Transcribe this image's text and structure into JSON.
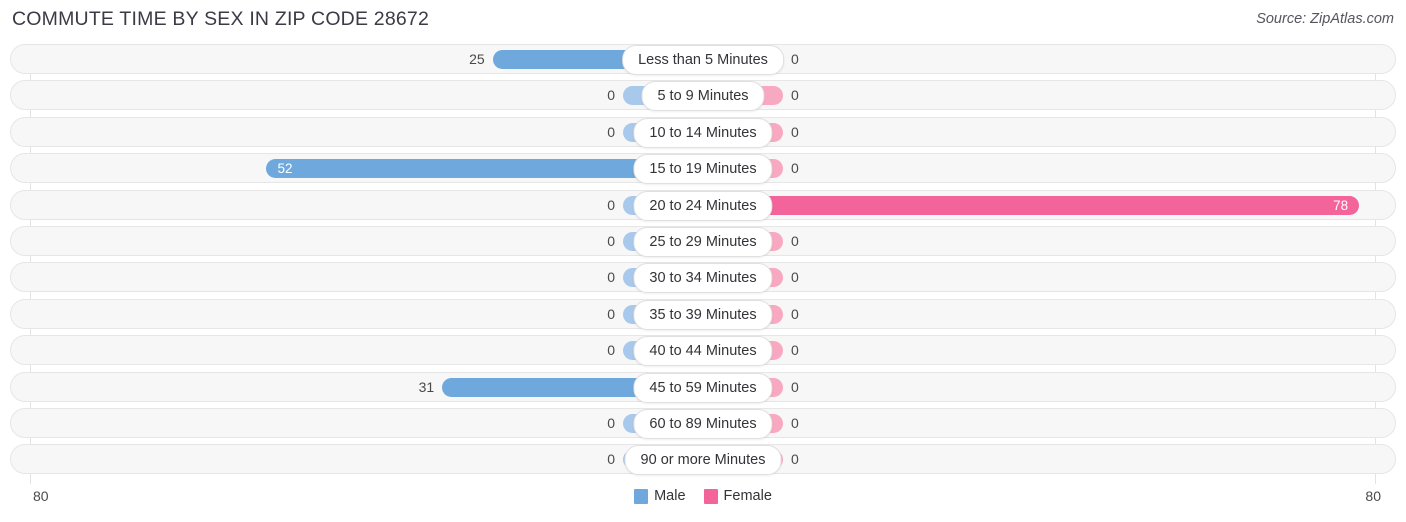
{
  "header": {
    "title": "COMMUTE TIME BY SEX IN ZIP CODE 28672",
    "source": "Source: ZipAtlas.com"
  },
  "legend": {
    "male_label": "Male",
    "female_label": "Female",
    "male_color": "#6fa8dc",
    "female_color": "#f2649a",
    "male_zero_color": "#a8c8ec",
    "female_zero_color": "#f9a8c2"
  },
  "axis": {
    "left_max": "80",
    "right_max": "80",
    "max_value": 80
  },
  "chart_data": {
    "type": "bar",
    "orientation": "horizontal-diverging",
    "title": "COMMUTE TIME BY SEX IN ZIP CODE 28672",
    "xlabel": "",
    "ylabel": "",
    "xlim": [
      80,
      80
    ],
    "grid": false,
    "legend_position": "bottom-center",
    "categories": [
      "Less than 5 Minutes",
      "5 to 9 Minutes",
      "10 to 14 Minutes",
      "15 to 19 Minutes",
      "20 to 24 Minutes",
      "25 to 29 Minutes",
      "30 to 34 Minutes",
      "35 to 39 Minutes",
      "40 to 44 Minutes",
      "45 to 59 Minutes",
      "60 to 89 Minutes",
      "90 or more Minutes"
    ],
    "series": [
      {
        "name": "Male",
        "values": [
          25,
          0,
          0,
          52,
          0,
          0,
          0,
          0,
          0,
          31,
          0,
          0
        ]
      },
      {
        "name": "Female",
        "values": [
          0,
          0,
          0,
          0,
          78,
          0,
          0,
          0,
          0,
          0,
          0,
          0
        ]
      }
    ]
  },
  "rows": [
    {
      "label": "Less than 5 Minutes",
      "male": "25",
      "female": "0",
      "male_value": 25,
      "female_value": 0
    },
    {
      "label": "5 to 9 Minutes",
      "male": "0",
      "female": "0",
      "male_value": 0,
      "female_value": 0
    },
    {
      "label": "10 to 14 Minutes",
      "male": "0",
      "female": "0",
      "male_value": 0,
      "female_value": 0
    },
    {
      "label": "15 to 19 Minutes",
      "male": "52",
      "female": "0",
      "male_value": 52,
      "female_value": 0
    },
    {
      "label": "20 to 24 Minutes",
      "male": "0",
      "female": "78",
      "male_value": 0,
      "female_value": 78
    },
    {
      "label": "25 to 29 Minutes",
      "male": "0",
      "female": "0",
      "male_value": 0,
      "female_value": 0
    },
    {
      "label": "30 to 34 Minutes",
      "male": "0",
      "female": "0",
      "male_value": 0,
      "female_value": 0
    },
    {
      "label": "35 to 39 Minutes",
      "male": "0",
      "female": "0",
      "male_value": 0,
      "female_value": 0
    },
    {
      "label": "40 to 44 Minutes",
      "male": "0",
      "female": "0",
      "male_value": 0,
      "female_value": 0
    },
    {
      "label": "45 to 59 Minutes",
      "male": "31",
      "female": "0",
      "male_value": 31,
      "female_value": 0
    },
    {
      "label": "60 to 89 Minutes",
      "male": "0",
      "female": "0",
      "male_value": 0,
      "female_value": 0
    },
    {
      "label": "90 or more Minutes",
      "male": "0",
      "female": "0",
      "male_value": 0,
      "female_value": 0
    }
  ]
}
